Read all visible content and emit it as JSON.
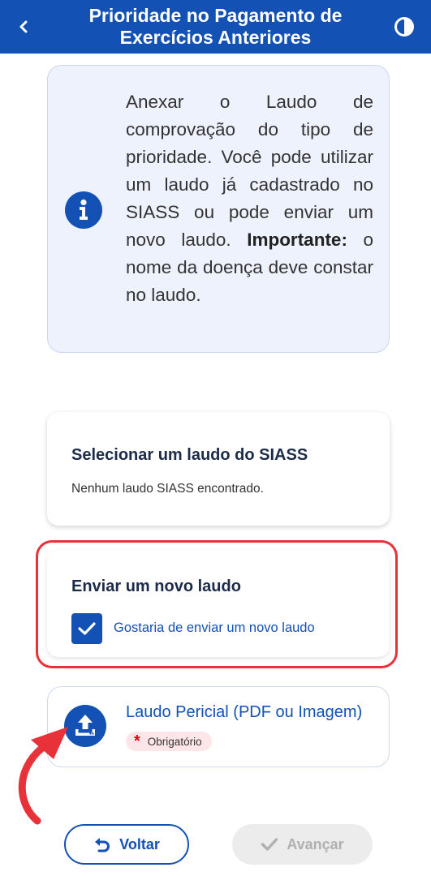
{
  "header": {
    "title": "Prioridade no Pagamento de Exercícios Anteriores",
    "back_icon": "chevron-left-icon",
    "contrast_icon": "contrast-icon",
    "background": "#1351b4"
  },
  "info": {
    "icon": "info-icon",
    "text": "Anexar o Laudo de comprovação do tipo de prioridade. Você pode utilizar um laudo já cadastrado no SIASS ou pode enviar um novo laudo.",
    "important_label": "Importante:",
    "important_text": " o nome da doença deve constar no laudo."
  },
  "siass": {
    "title": "Selecionar um laudo do SIASS",
    "message": "Nenhum laudo SIASS encontrado."
  },
  "novo_laudo": {
    "title": "Enviar um novo laudo",
    "checkbox_label": "Gostaria de enviar um novo laudo",
    "checked": true
  },
  "upload": {
    "icon": "upload-icon",
    "label": "Laudo Pericial (PDF ou Imagem)",
    "badge": "Obrigatório"
  },
  "footer": {
    "back_label": "Voltar",
    "next_label": "Avançar"
  },
  "colors": {
    "primary": "#1351b4",
    "highlight": "#e8323a",
    "required": "#e00010"
  }
}
